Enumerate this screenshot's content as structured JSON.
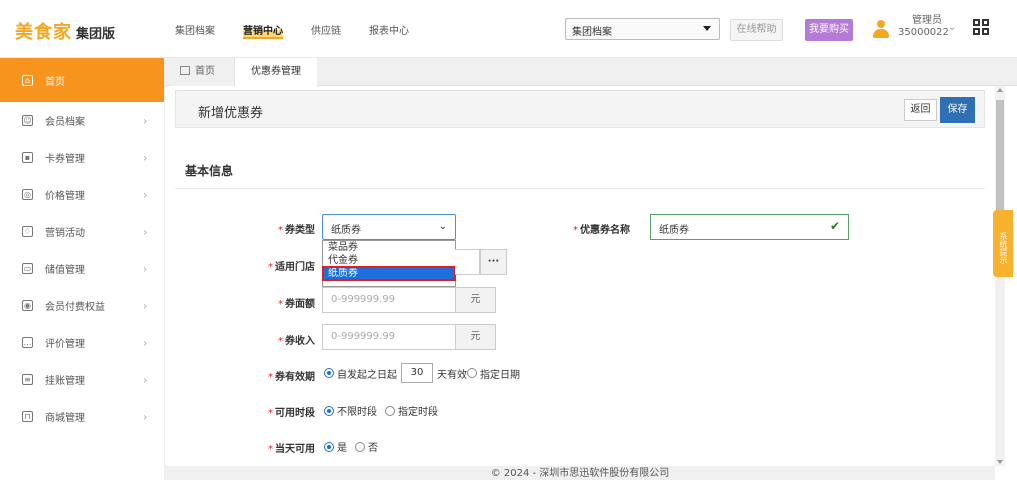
{
  "brand": {
    "name": "美食家",
    "edition": "集团版"
  },
  "topnav": [
    {
      "label": "集团档案"
    },
    {
      "label": "营销中心",
      "active": true
    },
    {
      "label": "供应链"
    },
    {
      "label": "报表中心"
    }
  ],
  "group_select": {
    "value": "集团档案"
  },
  "header_buttons": {
    "help": "在线帮助",
    "buy": "我要购买"
  },
  "user": {
    "role": "管理员",
    "id": "35000022"
  },
  "sidebar": {
    "items": [
      {
        "label": "首页",
        "icon": "home-icon",
        "active": true
      },
      {
        "label": "会员档案",
        "icon": "member-icon"
      },
      {
        "label": "卡券管理",
        "icon": "card-icon"
      },
      {
        "label": "价格管理",
        "icon": "price-icon"
      },
      {
        "label": "营销活动",
        "icon": "marketing-icon"
      },
      {
        "label": "储值管理",
        "icon": "stored-value-icon"
      },
      {
        "label": "会员付费权益",
        "icon": "paid-benefit-icon"
      },
      {
        "label": "评价管理",
        "icon": "review-icon"
      },
      {
        "label": "挂账管理",
        "icon": "credit-icon"
      },
      {
        "label": "商城管理",
        "icon": "mall-icon"
      }
    ]
  },
  "tabs": {
    "home": "首页",
    "active": "优惠券管理"
  },
  "page": {
    "title": "新增优惠券",
    "back": "返回",
    "save": "保存",
    "section": "基本信息"
  },
  "form": {
    "coupon_type": {
      "label": "券类型",
      "value": "纸质券",
      "options": [
        "菜品券",
        "代金券",
        "纸质券"
      ],
      "selected_index": 2
    },
    "coupon_name": {
      "label": "优惠券名称",
      "value": "纸质券"
    },
    "store": {
      "label": "适用门店",
      "button": "···"
    },
    "face_value": {
      "label": "券面额",
      "placeholder": "0-999999.99",
      "unit": "元"
    },
    "income": {
      "label": "券收入",
      "placeholder": "0-999999.99",
      "unit": "元"
    },
    "validity": {
      "label": "券有效期",
      "opt1_prefix": "自发起之日起",
      "days": "30",
      "opt1_suffix": "天有效",
      "opt2": "指定日期"
    },
    "time_period": {
      "label": "可用时段",
      "opt1": "不限时段",
      "opt2": "指定时段"
    },
    "same_day": {
      "label": "当天可用",
      "opt1": "是",
      "opt2": "否"
    }
  },
  "side_tip": "系统提示",
  "footer": "© 2024 - 深圳市思迅软件股份有限公司",
  "colors": {
    "brand": "#f5a623",
    "sidebar_active": "#f7941d",
    "save": "#2f6fb3",
    "buy": "#b57bd9",
    "required": "#e02020"
  }
}
